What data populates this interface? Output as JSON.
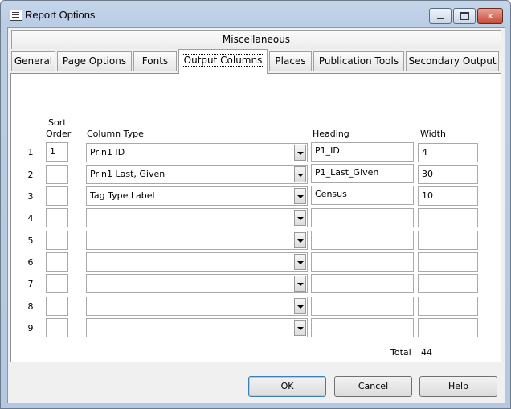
{
  "window": {
    "title": "Report Options",
    "buttons": {
      "minimize": "",
      "maximize": "",
      "close": "✕"
    }
  },
  "top_tab": "Miscellaneous",
  "tabs": [
    {
      "label": "General"
    },
    {
      "label": "Page Options"
    },
    {
      "label": "Fonts"
    },
    {
      "label": "Output Columns",
      "active": true
    },
    {
      "label": "Places"
    },
    {
      "label": "Publication Tools"
    },
    {
      "label": "Secondary Output"
    }
  ],
  "columns_header": {
    "sort_order_line1": "Sort",
    "sort_order_line2": "Order",
    "column_type": "Column Type",
    "heading": "Heading",
    "width": "Width"
  },
  "rows": [
    {
      "num": "1",
      "sort": "1",
      "type": "Prin1 ID",
      "heading": "P1_ID",
      "width": "4"
    },
    {
      "num": "2",
      "sort": "",
      "type": "Prin1 Last, Given",
      "heading": "P1_Last_Given",
      "width": "30"
    },
    {
      "num": "3",
      "sort": "",
      "type": "Tag Type Label",
      "heading": "Census",
      "width": "10"
    },
    {
      "num": "4",
      "sort": "",
      "type": "",
      "heading": "",
      "width": ""
    },
    {
      "num": "5",
      "sort": "",
      "type": "",
      "heading": "",
      "width": ""
    },
    {
      "num": "6",
      "sort": "",
      "type": "",
      "heading": "",
      "width": ""
    },
    {
      "num": "7",
      "sort": "",
      "type": "",
      "heading": "",
      "width": ""
    },
    {
      "num": "8",
      "sort": "",
      "type": "",
      "heading": "",
      "width": ""
    },
    {
      "num": "9",
      "sort": "",
      "type": "",
      "heading": "",
      "width": ""
    }
  ],
  "total": {
    "label": "Total",
    "value": "44"
  },
  "footer": {
    "ok": "OK",
    "cancel": "Cancel",
    "help": "Help"
  }
}
